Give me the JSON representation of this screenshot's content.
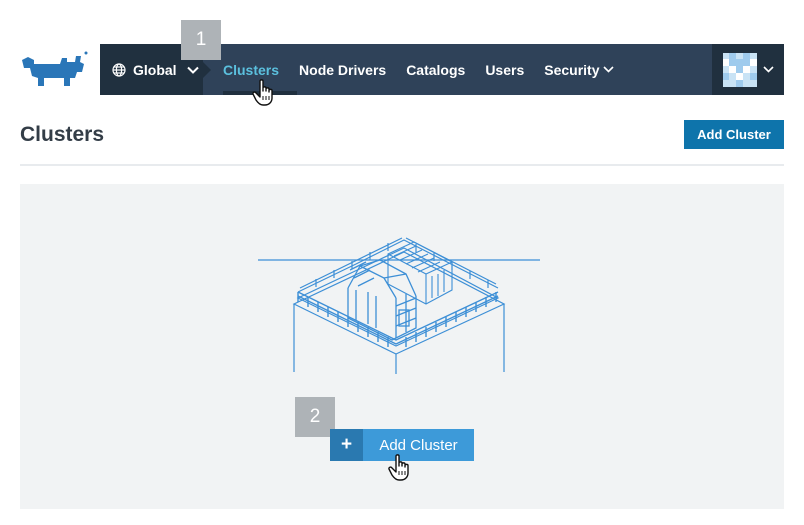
{
  "navbar": {
    "scope_label": "Global",
    "items": [
      {
        "label": "Clusters"
      },
      {
        "label": "Node Drivers"
      },
      {
        "label": "Catalogs"
      },
      {
        "label": "Users"
      },
      {
        "label": "Security"
      }
    ]
  },
  "steps": {
    "first": "1",
    "second": "2"
  },
  "page": {
    "title": "Clusters",
    "add_button_label": "Add Cluster"
  },
  "empty_state": {
    "add_button_label": "Add Cluster",
    "plus_symbol": "+"
  },
  "colors": {
    "nav_bg": "#2f4259",
    "nav_dark": "#20303f",
    "active_link": "#5bc0de",
    "primary_button": "#0e74ab",
    "accent_button": "#3d9ad9",
    "brand_blue": "#2a76b8"
  },
  "icons": {
    "logo": "rancher-cow-logo",
    "scope": "globe-icon",
    "dropdown": "chevron-down-icon",
    "pointer": "hand-cursor-icon"
  }
}
